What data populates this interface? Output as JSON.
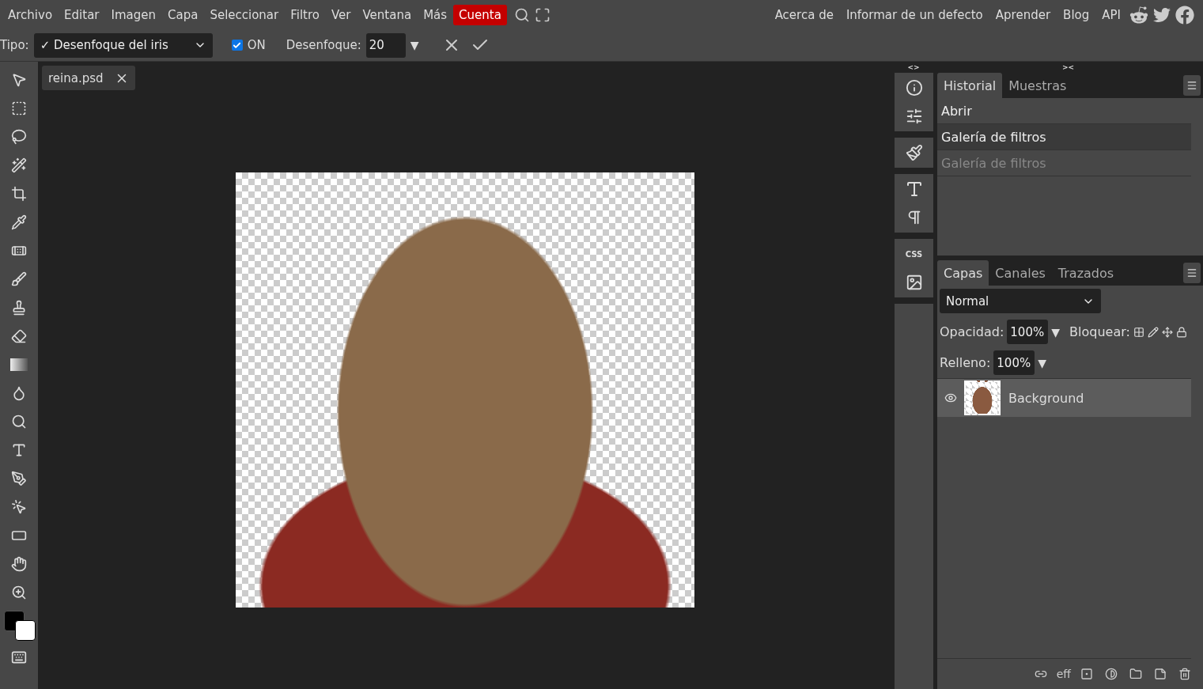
{
  "menu": [
    {
      "label": "Archivo",
      "kind": "menu"
    },
    {
      "label": "Editar",
      "kind": "menu"
    },
    {
      "label": "Imagen",
      "kind": "menu"
    },
    {
      "label": "Capa",
      "kind": "menu"
    },
    {
      "label": "Seleccionar",
      "kind": "menu"
    },
    {
      "label": "Filtro",
      "kind": "menu"
    },
    {
      "label": "Ver",
      "kind": "menu"
    },
    {
      "label": "Ventana",
      "kind": "menu"
    },
    {
      "label": "Más",
      "kind": "menu"
    },
    {
      "label": "Cuenta",
      "kind": "account"
    }
  ],
  "links": [
    "Acerca de",
    "Informar de un defecto",
    "Aprender",
    "Blog",
    "API"
  ],
  "options": {
    "type_label": "Tipo:",
    "type_value": "✓ Desenfoque del iris",
    "on_label": "ON",
    "on_checked": true,
    "blur_label": "Desenfoque:",
    "blur_value": "20",
    "blur_arrow": "▼"
  },
  "document_tab": {
    "title": "reina.psd"
  },
  "panel_toggles": {
    "left": "<>",
    "right": "><"
  },
  "side_icons": {
    "css_label": "CSS"
  },
  "history": {
    "tabs": [
      {
        "label": "Historial",
        "selected": true
      },
      {
        "label": "Muestras",
        "selected": false
      }
    ],
    "items": [
      {
        "label": "Abrir",
        "selected": false,
        "disabled": false
      },
      {
        "label": "Galería de filtros",
        "selected": true,
        "disabled": false
      },
      {
        "label": "Galería de filtros",
        "selected": false,
        "disabled": true
      }
    ]
  },
  "layers": {
    "tabs": [
      {
        "label": "Capas",
        "selected": true
      },
      {
        "label": "Canales",
        "selected": false
      },
      {
        "label": "Trazados",
        "selected": false
      }
    ],
    "blend_mode": "Normal",
    "opacity_label": "Opacidad:",
    "opacity_value": "100%",
    "opacity_arrow": "▼",
    "lock_label": "Bloquear:",
    "fill_label": "Relleno:",
    "fill_value": "100%",
    "fill_arrow": "▼",
    "items": [
      {
        "name": "Background",
        "visible": true,
        "selected": true
      }
    ],
    "effects_label": "eff"
  }
}
